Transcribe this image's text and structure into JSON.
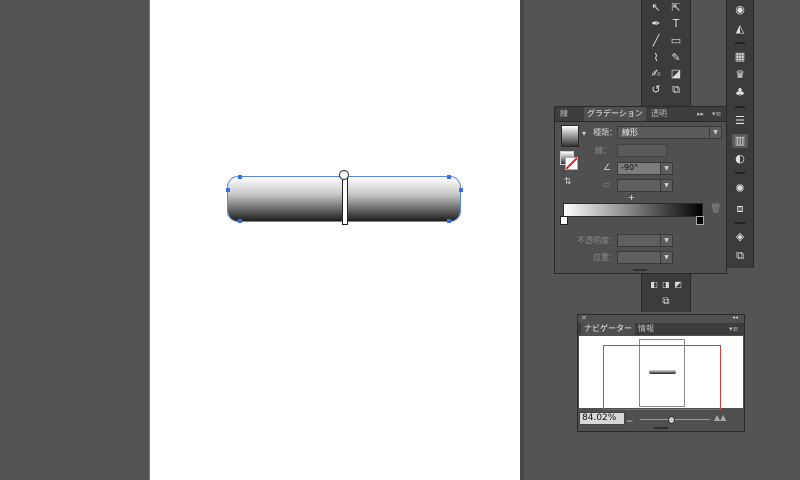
{
  "gradient_panel": {
    "tabs": [
      "線",
      "グラデーション",
      "透明"
    ],
    "type_label": "種類：",
    "type_value": "線形",
    "stroke_label": "線：",
    "angle_value": "-90°",
    "opacity_label": "不透明度：",
    "location_label": "位置：",
    "plus": "+"
  },
  "navigator_panel": {
    "tabs": [
      "ナビゲーター",
      "情報"
    ],
    "zoom_value": "84.02%"
  },
  "tools": {
    "icons": [
      "selection-icon",
      "direct-selection-icon",
      "pen-icon",
      "type-icon",
      "line-icon",
      "rectangle-icon",
      "brush-icon",
      "pencil-icon",
      "blob-brush-icon",
      "eraser-icon",
      "rotate-icon",
      "scale-icon"
    ]
  },
  "dock": {
    "icons": [
      "color-guide-icon",
      "brushes-icon",
      "swatches-icon",
      "symbols-icon",
      "clubs-icon",
      "stroke-icon",
      "gradient-icon",
      "transparency-icon",
      "appearance-icon",
      "graphic-styles-icon",
      "layers-icon",
      "artboards-icon"
    ]
  },
  "colors": {
    "canvas_bg": "#535353",
    "artboard_border": "#d94a4a",
    "selection_blue": "#3b6fe0",
    "navigator_frame": "#e03a3a"
  }
}
